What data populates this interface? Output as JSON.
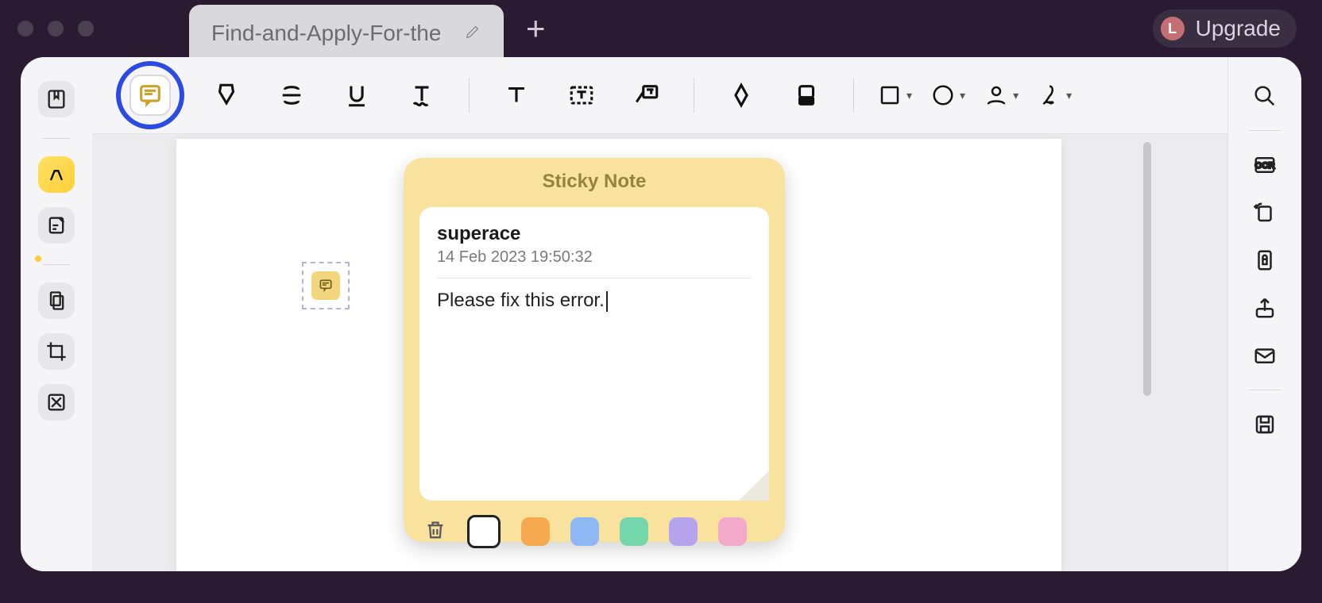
{
  "titlebar": {
    "tab_title": "Find-and-Apply-For-the-Be",
    "upgrade_label": "Upgrade",
    "avatar_initial": "L"
  },
  "left_toolbar": {
    "items": [
      {
        "name": "bookmarks-panel-icon"
      },
      {
        "name": "highlighter-tool-icon"
      },
      {
        "name": "notes-panel-icon"
      },
      {
        "name": "page-manage-icon"
      },
      {
        "name": "crop-tool-icon"
      },
      {
        "name": "redact-tool-icon"
      }
    ]
  },
  "ribbon": {
    "annotate_note": "Sticky Note",
    "items": [
      "sticky-note-tool",
      "highlight-tool",
      "strikethrough-tool",
      "underline-tool",
      "squiggly-tool",
      "text-annotation-tool",
      "textbox-tool",
      "callout-tool",
      "pencil-tool",
      "eraser-tool",
      "shape-tool",
      "circle-tool",
      "user-tool",
      "sign-tool"
    ]
  },
  "sticky_note": {
    "title": "Sticky Note",
    "author": "superace",
    "timestamp": "14 Feb 2023 19:50:32",
    "content": "Please fix this error.",
    "colors": {
      "default": "#ffffff",
      "orange": "#f6a94f",
      "blue": "#8db8f3",
      "green": "#74d7ab",
      "purple": "#b6a3ee",
      "pink": "#f2a9ca"
    }
  },
  "right_toolbar": {
    "items": [
      "search-icon",
      "ocr-icon",
      "rotate-icon",
      "lock-page-icon",
      "share-icon",
      "mail-icon",
      "save-icon"
    ],
    "ocr_label": "OCR"
  }
}
